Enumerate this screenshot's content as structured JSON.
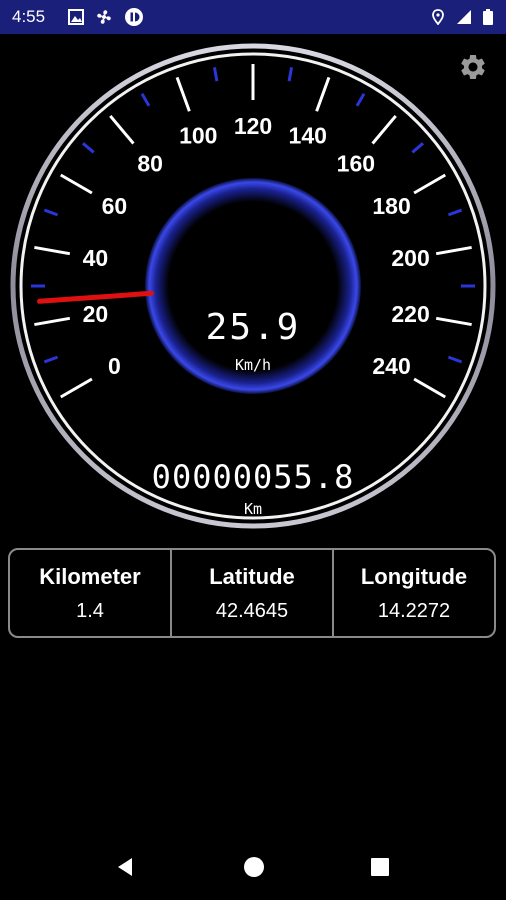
{
  "status_bar": {
    "time": "4:55",
    "bg_color": "#1a1f7a",
    "left_icons": [
      "picture-icon",
      "fan-icon",
      "pause-circle-icon"
    ],
    "right_icons": [
      "location-icon",
      "signal-icon",
      "battery-icon"
    ]
  },
  "settings": {
    "icon": "gear-icon"
  },
  "speedometer": {
    "ticks": [
      "0",
      "20",
      "40",
      "60",
      "80",
      "100",
      "120",
      "140",
      "160",
      "180",
      "200",
      "220",
      "240"
    ],
    "min": 0,
    "max": 240,
    "speed": "25.9",
    "speed_unit": "Km/h",
    "odometer": "00000055.8",
    "odometer_unit": "Km",
    "needle_color": "#e01010",
    "accent_color": "#2a36d8"
  },
  "info_panel": {
    "columns": [
      {
        "label": "Kilometer",
        "value": "1.4"
      },
      {
        "label": "Latitude",
        "value": "42.4645"
      },
      {
        "label": "Longitude",
        "value": "14.2272"
      }
    ]
  },
  "nav_bar": {
    "icons": [
      "back-icon",
      "home-icon",
      "recents-icon"
    ]
  }
}
